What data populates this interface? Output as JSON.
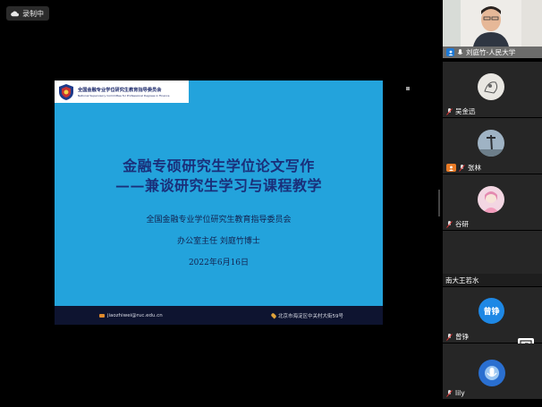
{
  "recording": {
    "label": "录制中"
  },
  "slide": {
    "org_cn": "全国金融专业学位研究生教育指导委员会",
    "org_en": "National Supervisory Committee for Professional Degrees in Finance",
    "title_line1": "金融专硕研究生学位论文写作",
    "title_line2": "——兼谈研究生学习与课程教学",
    "body_line1": "全国金融专业学位研究生教育指导委员会",
    "body_line2": "办公室主任    刘庭竹博士",
    "body_line3": "2022年6月16日",
    "footer_email": "jiaozhiwei@ruc.edu.cn",
    "footer_address": "北京市海淀区中关村大街59号",
    "colors": {
      "background": "#23a3dc",
      "title": "#1a2f7a",
      "footer": "#0e1430"
    }
  },
  "participants": [
    {
      "name": "刘庭竹-人民大学",
      "role": "host",
      "video": true
    },
    {
      "name": "吴金迅",
      "avatar": "image"
    },
    {
      "name": "张林",
      "avatar": "image",
      "role": "cohost"
    },
    {
      "name": "谷研",
      "avatar": "image"
    },
    {
      "name": "南大王若水",
      "avatar": "none"
    },
    {
      "name": "曾铮",
      "avatar_text": "曾铮"
    },
    {
      "name": "lily",
      "avatar": "image"
    }
  ]
}
